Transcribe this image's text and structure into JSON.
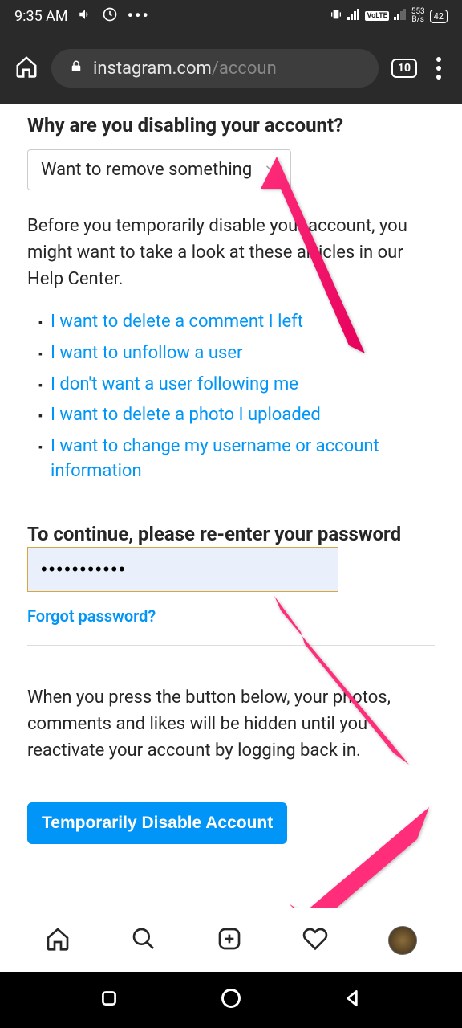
{
  "status": {
    "time": "9:35 AM",
    "speed_top": "553",
    "speed_bot": "B/s",
    "volte": "VoLTE",
    "battery": "42"
  },
  "browser": {
    "url_host": "instagram.com",
    "url_path": "/accoun",
    "tab_count": "10"
  },
  "content": {
    "heading1": "Why are you disabling your account?",
    "dropdown_value": "Want to remove something",
    "help_text": "Before you temporarily disable your account, you might want to take a look at these articles in our Help Center.",
    "links": [
      "I want to delete a comment I left",
      "I want to unfollow a user",
      "I don't want a user following me",
      "I want to delete a photo I uploaded",
      "I want to change my username or account information"
    ],
    "heading2": "To continue, please re-enter your password",
    "pwd_value": "•••••••••••",
    "forgot": "Forgot password?",
    "warn": "When you press the button below, your photos, comments and likes will be hidden until you reactivate your account by logging back in.",
    "button": "Temporarily Disable Account"
  }
}
